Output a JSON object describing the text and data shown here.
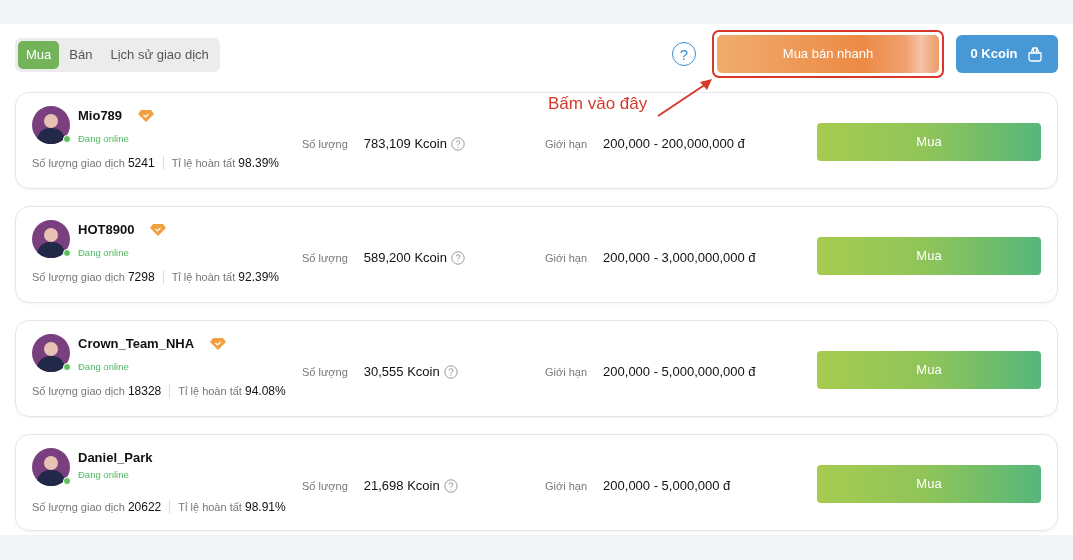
{
  "tabs": [
    {
      "label": "Mua",
      "selected": true
    },
    {
      "label": "Bán",
      "selected": false
    },
    {
      "label": "Lịch sử giao dịch",
      "selected": false
    }
  ],
  "help_button": {
    "label": "?"
  },
  "quick_trade_button": {
    "label": "Mua bán nhanh",
    "highlighted": true
  },
  "balance_button": {
    "label": "0 Kcoin"
  },
  "annotation": {
    "text": "Bấm vào đây"
  },
  "offers": [
    {
      "name": "Mio789",
      "verified": true,
      "online": true,
      "status": "Đang online",
      "trades_label": "Số lượng giao dịch",
      "trades": "5241",
      "rate_label": "Tỉ lệ hoàn tất",
      "rate": "98.39%",
      "amount_label": "Số lượng",
      "amount": "783,109 Kcoin",
      "limit_label": "Giới hạn",
      "limit": "200,000 - 200,000,000 đ",
      "action": "Mua"
    },
    {
      "name": "HOT8900",
      "verified": true,
      "online": true,
      "status": "Đang online",
      "trades_label": "Số lượng giao dịch",
      "trades": "7298",
      "rate_label": "Tỉ lệ hoàn tất",
      "rate": "92.39%",
      "amount_label": "Số lượng",
      "amount": "589,200 Kcoin",
      "limit_label": "Giới hạn",
      "limit": "200,000 - 3,000,000,000 đ",
      "action": "Mua"
    },
    {
      "name": "Crown_Team_NHA",
      "verified": true,
      "online": true,
      "status": "Đang online",
      "trades_label": "Số lượng giao dịch",
      "trades": "18328",
      "rate_label": "Tỉ lệ hoàn tất",
      "rate": "94.08%",
      "amount_label": "Số lượng",
      "amount": "30,555 Kcoin",
      "limit_label": "Giới hạn",
      "limit": "200,000 - 5,000,000,000 đ",
      "action": "Mua"
    },
    {
      "name": "Daniel_Park",
      "verified": false,
      "online": true,
      "status": "Đang online",
      "trades_label": "Số lượng giao dịch",
      "trades": "20622",
      "rate_label": "Tỉ lệ hoàn tất",
      "rate": "98.91%",
      "amount_label": "Số lượng",
      "amount": "21,698 Kcoin",
      "limit_label": "Giới hạn",
      "limit": "200,000 - 5,000,000 đ",
      "action": "Mua"
    }
  ]
}
